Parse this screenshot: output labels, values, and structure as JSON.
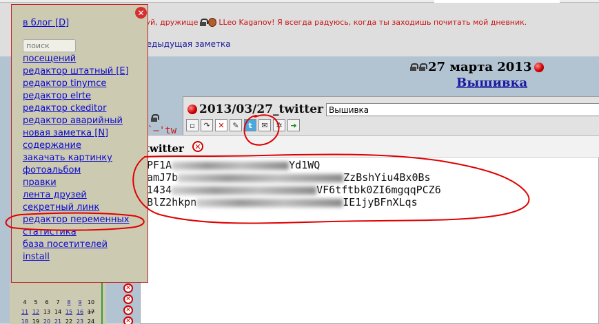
{
  "page": {
    "greeting": "вуй, дружище",
    "greeting_user": "LLeo Kaganov! Я всегда радуюсь, когда ты заходишь почитать мой дневник.",
    "previous_note": "редыдущая заметка",
    "date": "27 марта 2013",
    "post_link": "Вышивка",
    "bg_red_text": "`–'tw"
  },
  "menu": {
    "blog_link": "в блог [D]",
    "search_placeholder": "поиск",
    "items": [
      "посещений",
      "редактор штатный [E]",
      "редактор tinymce",
      "редактор elrte",
      "редактор ckeditor",
      "редактор аварийный",
      "новая заметка [N]",
      "содержание",
      "закачать картинку",
      "фотоальбом",
      "правки",
      "лента друзей",
      "секретный линк",
      "редактор переменных",
      "статистика",
      "база посетителей",
      "install"
    ]
  },
  "editor": {
    "title": "2013/03/27_twitter",
    "title_input_value": "Вышивка",
    "toolbar_icons": [
      "new-icon",
      "forward-icon",
      "cancel-icon",
      "edit-icon",
      "twitter-icon",
      "mail-icon",
      "settings-icon",
      "go-icon"
    ]
  },
  "twitter_popup": {
    "title": "twitter",
    "lines": [
      {
        "start": "PF1A",
        "end": "Yd1WQ"
      },
      {
        "start": "amJ7b",
        "end": "ZzBshYiu4Bx0Bs"
      },
      {
        "start": "1434",
        "end": "VF6tftbk0ZI6mgqqPCZ6"
      },
      {
        "start": "BlZ2hkpn",
        "end": "IE1jyBFnXLqs"
      }
    ]
  },
  "calendar": {
    "rows": [
      [
        "4",
        "5",
        "6",
        "7",
        "8",
        "9",
        "10"
      ],
      [
        "11",
        "12",
        "13",
        "14",
        "15",
        "16",
        "17"
      ],
      [
        "18",
        "19",
        "20",
        "21",
        "22",
        "23",
        "24"
      ]
    ]
  },
  "colors": {
    "menu_bg": "#cdcab2",
    "link": "#0b0bcf",
    "annotation": "#e00000",
    "band": "#b2c3d2"
  }
}
